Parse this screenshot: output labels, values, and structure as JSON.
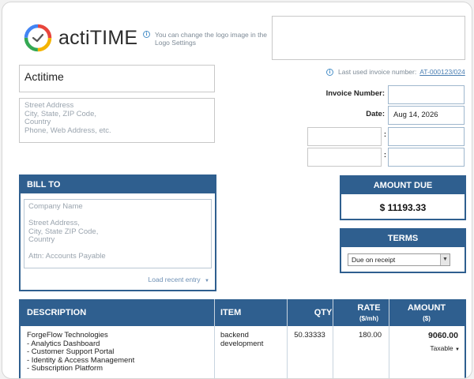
{
  "logo": {
    "name": "actiTIME",
    "note": "You can change the logo image in the Logo Settings",
    "ring_colors": [
      "#e8453c",
      "#f4b400",
      "#34a853",
      "#4285f4"
    ]
  },
  "last_used": {
    "label": "Last used invoice number:",
    "value": "AT-000123/024"
  },
  "company": {
    "name": "Actitime",
    "address_placeholder": "Street Address\nCity, State, ZIP Code,\nCountry\nPhone, Web Address, etc."
  },
  "invoice_fields": {
    "number_label": "Invoice Number:",
    "number_value": "",
    "date_label": "Date:",
    "date_value": "Aug 14, 2026",
    "extra1_label": "",
    "extra1_value": "",
    "extra2_label": "",
    "extra2_value": ""
  },
  "bill_to": {
    "title": "BILL TO",
    "placeholder": "Company Name\n\nStreet Address,\nCity, State ZIP Code,\nCountry\n\nAttn: Accounts Payable",
    "load_recent": "Load recent entry"
  },
  "amount_due": {
    "title": "AMOUNT DUE",
    "value": "$ 11193.33"
  },
  "terms": {
    "title": "TERMS",
    "selected": "Due on receipt"
  },
  "table": {
    "headers": {
      "description": "DESCRIPTION",
      "item": "ITEM",
      "qty": "QTY",
      "rate": "RATE",
      "rate_sub": "($/mh)",
      "amount": "AMOUNT",
      "amount_sub": "($)"
    },
    "rows": [
      {
        "description": "ForgeFlow Technologies\n- Analytics Dashboard\n- Customer Support Portal\n- Identity & Access Management\n- Subscription Platform",
        "item": "backend\ndevelopment",
        "qty": "50.33333",
        "rate": "180.00",
        "amount": "9060.00",
        "tax": "Taxable"
      }
    ]
  },
  "colors": {
    "header_blue": "#2f5f8f",
    "link_blue": "#4b7fb3"
  }
}
